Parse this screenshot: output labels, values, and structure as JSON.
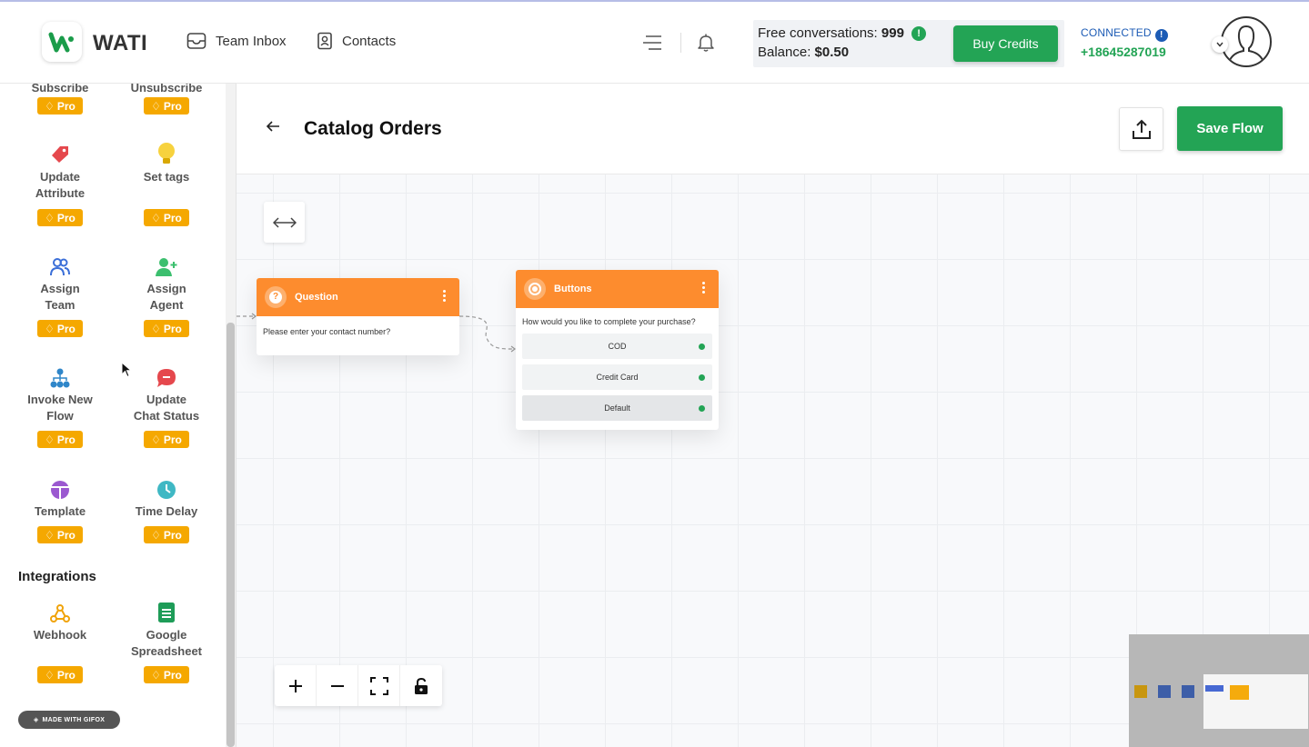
{
  "app": {
    "name": "WATI",
    "nav": [
      {
        "label": "Team Inbox",
        "icon": "inbox-icon"
      },
      {
        "label": "Contacts",
        "icon": "contacts-icon"
      }
    ]
  },
  "credits": {
    "free_label": "Free conversations:",
    "free_value": "999",
    "balance_label": "Balance:",
    "balance_value": "$0.50",
    "buy_label": "Buy Credits"
  },
  "connection": {
    "status": "CONNECTED",
    "phone": "+18645287019"
  },
  "sidebar": {
    "partial_labels": [
      "Subscribe",
      "Unsubscribe"
    ],
    "pro_label": "Pro",
    "items": [
      {
        "label_1": "Update",
        "label_2": "Attribute",
        "icon": "tag-icon"
      },
      {
        "label_1": "Set tags",
        "label_2": "",
        "icon": "lightbulb-icon"
      },
      {
        "label_1": "Assign",
        "label_2": "Team",
        "icon": "team-icon"
      },
      {
        "label_1": "Assign",
        "label_2": "Agent",
        "icon": "add-agent-icon"
      },
      {
        "label_1": "Invoke New",
        "label_2": "Flow",
        "icon": "flow-tree-icon"
      },
      {
        "label_1": "Update",
        "label_2": "Chat Status",
        "icon": "chat-status-icon"
      },
      {
        "label_1": "Template",
        "label_2": "",
        "icon": "template-icon"
      },
      {
        "label_1": "Time Delay",
        "label_2": "",
        "icon": "clock-icon"
      }
    ],
    "integrations_title": "Integrations",
    "integrations": [
      {
        "label_1": "Webhook",
        "label_2": "",
        "icon": "webhook-icon"
      },
      {
        "label_1": "Google",
        "label_2": "Spreadsheet",
        "icon": "spreadsheet-icon"
      }
    ],
    "watermark": "MADE WITH GIFOX"
  },
  "main": {
    "title": "Catalog Orders",
    "save_label": "Save Flow"
  },
  "flow": {
    "question_node": {
      "title": "Question",
      "text": "Please enter your contact number?"
    },
    "buttons_node": {
      "title": "Buttons",
      "text": "How would you like to complete your purchase?",
      "choices": [
        "COD",
        "Credit Card",
        "Default"
      ]
    }
  },
  "colors": {
    "brand_green": "#23a455",
    "node_orange": "#fd8c2e",
    "pro_badge": "#f5a800",
    "connected_blue": "#1c5bb5"
  }
}
